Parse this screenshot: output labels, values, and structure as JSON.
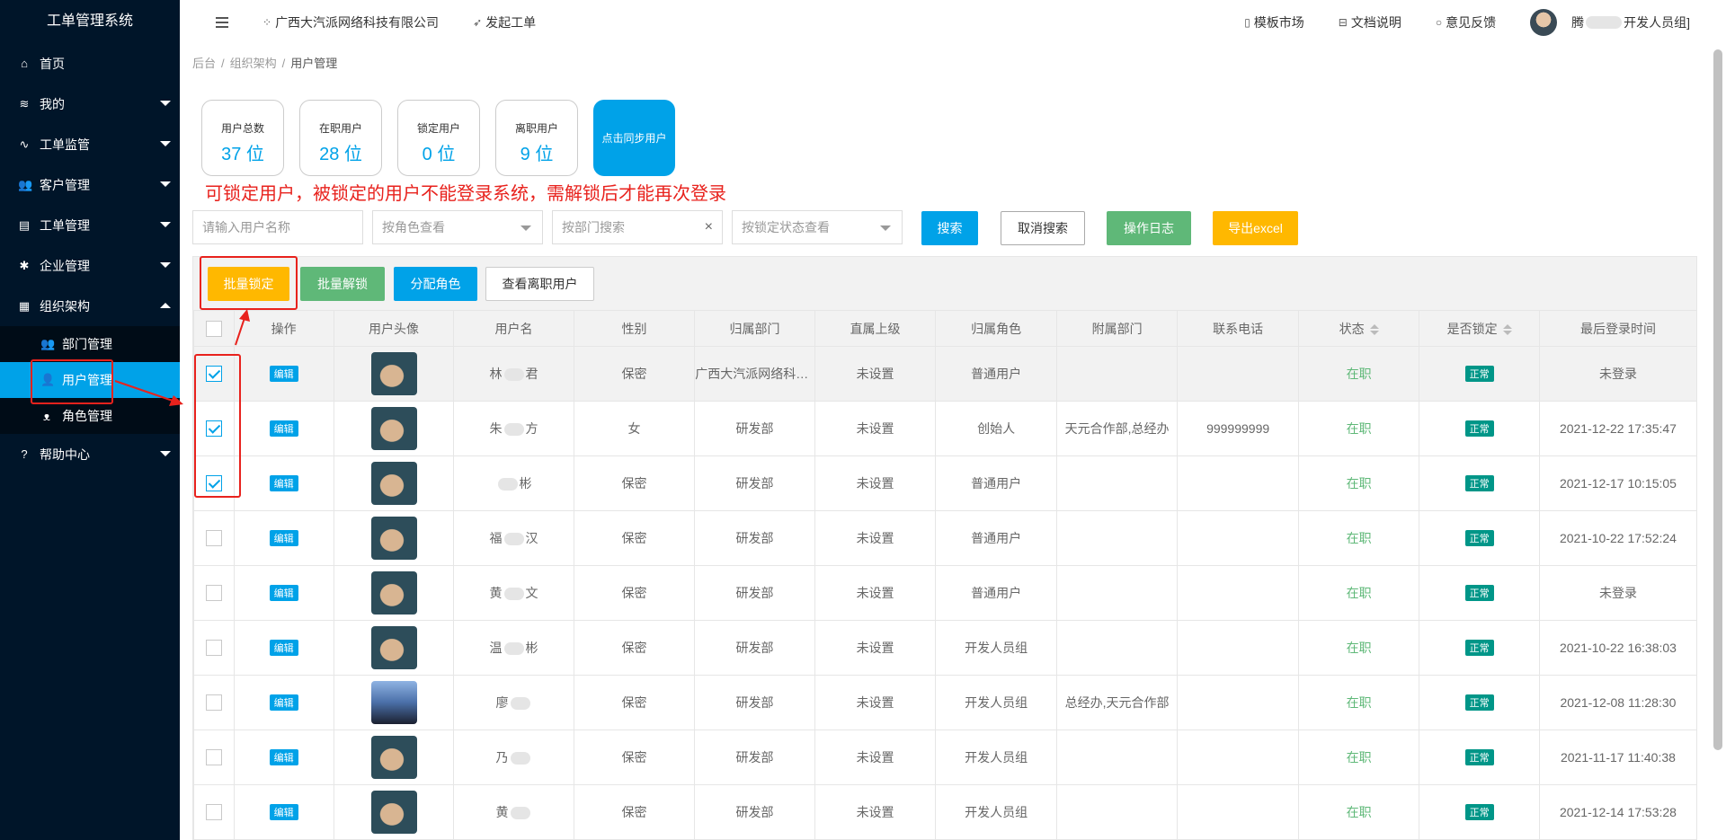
{
  "app": {
    "title": "工单管理系统"
  },
  "sidebar": {
    "items": [
      {
        "label": "首页",
        "icon": "home-icon"
      },
      {
        "label": "我的",
        "icon": "layers-icon"
      },
      {
        "label": "工单监管",
        "icon": "pulse-icon"
      },
      {
        "label": "客户管理",
        "icon": "users-icon"
      },
      {
        "label": "工单管理",
        "icon": "clipboard-icon"
      },
      {
        "label": "企业管理",
        "icon": "gear-icon"
      },
      {
        "label": "组织架构",
        "icon": "calendar-icon"
      }
    ],
    "submenu": [
      {
        "label": "部门管理",
        "icon": "group-icon"
      },
      {
        "label": "用户管理",
        "icon": "user-icon"
      },
      {
        "label": "角色管理",
        "icon": "person-outline-icon"
      }
    ],
    "help": {
      "label": "帮助中心",
      "icon": "question-icon"
    }
  },
  "header": {
    "company": "广西大汽派网络科技有限公司",
    "create_ticket": "发起工单",
    "template_market": "模板市场",
    "docs": "文档说明",
    "feedback": "意见反馈",
    "user_prefix": "腾",
    "user_suffix": "开发人员组]"
  },
  "breadcrumb": {
    "root": "后台",
    "mid": "组织架构",
    "current": "用户管理"
  },
  "stats": {
    "total_label": "用户总数",
    "total_value": "37 位",
    "active_label": "在职用户",
    "active_value": "28 位",
    "locked_label": "锁定用户",
    "locked_value": "0 位",
    "left_label": "离职用户",
    "left_value": "9 位",
    "sync_label": "点击同步用户"
  },
  "annotation": "可锁定用户，被锁定的用户不能登录系统，需解锁后才能再次登录",
  "search": {
    "name_placeholder": "请输入用户名称",
    "role_select": "按角色查看",
    "dept_placeholder": "按部门搜索",
    "lock_select": "按锁定状态查看",
    "search_btn": "搜索",
    "cancel_btn": "取消搜索",
    "log_btn": "操作日志",
    "export_btn": "导出excel"
  },
  "toolbar": {
    "batch_lock": "批量锁定",
    "batch_unlock": "批量解锁",
    "assign_role": "分配角色",
    "view_left": "查看离职用户"
  },
  "table": {
    "headers": [
      "操作",
      "用户头像",
      "用户名",
      "性别",
      "归属部门",
      "直属上级",
      "归属角色",
      "附属部门",
      "联系电话",
      "状态",
      "是否锁定",
      "最后登录时间"
    ],
    "edit_label": "编辑",
    "rows": [
      {
        "checked": true,
        "name_a": "林",
        "name_b": "君",
        "gender": "保密",
        "dept": "广西大汽派网络科技有限公司",
        "superior": "未设置",
        "role": "普通用户",
        "sub_dept": "",
        "phone": "",
        "status": "在职",
        "lock": "正常",
        "last_login": "未登录",
        "avatar": "boy"
      },
      {
        "checked": true,
        "name_a": "朱",
        "name_b": "方",
        "gender": "女",
        "dept": "研发部",
        "superior": "未设置",
        "role": "创始人",
        "sub_dept": "天元合作部,总经办",
        "phone": "999999999",
        "status": "在职",
        "lock": "正常",
        "last_login": "2021-12-22 17:35:47",
        "avatar": "boy"
      },
      {
        "checked": true,
        "name_a": "",
        "name_b": "彬",
        "gender": "保密",
        "dept": "研发部",
        "superior": "未设置",
        "role": "普通用户",
        "sub_dept": "",
        "phone": "",
        "status": "在职",
        "lock": "正常",
        "last_login": "2021-12-17 10:15:05",
        "avatar": "boy"
      },
      {
        "checked": false,
        "name_a": "福",
        "name_b": "汉",
        "gender": "保密",
        "dept": "研发部",
        "superior": "未设置",
        "role": "普通用户",
        "sub_dept": "",
        "phone": "",
        "status": "在职",
        "lock": "正常",
        "last_login": "2021-10-22 17:52:24",
        "avatar": "boy"
      },
      {
        "checked": false,
        "name_a": "黄",
        "name_b": "文",
        "gender": "保密",
        "dept": "研发部",
        "superior": "未设置",
        "role": "普通用户",
        "sub_dept": "",
        "phone": "",
        "status": "在职",
        "lock": "正常",
        "last_login": "未登录",
        "avatar": "boy"
      },
      {
        "checked": false,
        "name_a": "温",
        "name_b": "彬",
        "gender": "保密",
        "dept": "研发部",
        "superior": "未设置",
        "role": "开发人员组",
        "sub_dept": "",
        "phone": "",
        "status": "在职",
        "lock": "正常",
        "last_login": "2021-10-22 16:38:03",
        "avatar": "boy"
      },
      {
        "checked": false,
        "name_a": "廖",
        "name_b": "",
        "gender": "保密",
        "dept": "研发部",
        "superior": "未设置",
        "role": "开发人员组",
        "sub_dept": "总经办,天元合作部",
        "phone": "",
        "status": "在职",
        "lock": "正常",
        "last_login": "2021-12-08 11:28:30",
        "avatar": "alt"
      },
      {
        "checked": false,
        "name_a": "乃",
        "name_b": "",
        "gender": "保密",
        "dept": "研发部",
        "superior": "未设置",
        "role": "开发人员组",
        "sub_dept": "",
        "phone": "",
        "status": "在职",
        "lock": "正常",
        "last_login": "2021-11-17 11:40:38",
        "avatar": "boy"
      },
      {
        "checked": false,
        "name_a": "黄",
        "name_b": "",
        "gender": "保密",
        "dept": "研发部",
        "superior": "未设置",
        "role": "开发人员组",
        "sub_dept": "",
        "phone": "",
        "status": "在职",
        "lock": "正常",
        "last_login": "2021-12-14 17:53:28",
        "avatar": "boy"
      }
    ]
  },
  "colors": {
    "sidebar_bg": "#001529",
    "primary": "#00a2e8",
    "green": "#5fb878",
    "orange": "#ffb800",
    "annotation_red": "#e8221d"
  }
}
